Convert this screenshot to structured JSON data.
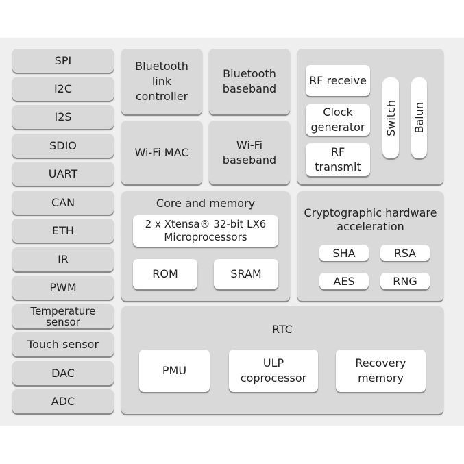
{
  "peripherals": [
    "SPI",
    "I2C",
    "I2S",
    "SDIO",
    "UART",
    "CAN",
    "ETH",
    "IR",
    "PWM",
    "Temperature sensor",
    "Touch sensor",
    "DAC",
    "ADC"
  ],
  "bluetooth_link_controller": "Bluetooth link controller",
  "bluetooth_baseband": "Bluetooth baseband",
  "wifi_mac": "Wi-Fi MAC",
  "wifi_baseband": "Wi-Fi baseband",
  "rf": {
    "receive": "RF receive",
    "clock": "Clock generator",
    "transmit": "RF transmit",
    "switch": "Switch",
    "balun": "Balun"
  },
  "core": {
    "title": "Core and memory",
    "cpu": "2 x Xtensa® 32-bit LX6 Microprocessors",
    "rom": "ROM",
    "sram": "SRAM"
  },
  "crypto": {
    "title": "Cryptographic hardware acceleration",
    "sha": "SHA",
    "rsa": "RSA",
    "aes": "AES",
    "rng": "RNG"
  },
  "rtc": {
    "title": "RTC",
    "pmu": "PMU",
    "ulp": "ULP coprocessor",
    "recovery": "Recovery memory"
  }
}
